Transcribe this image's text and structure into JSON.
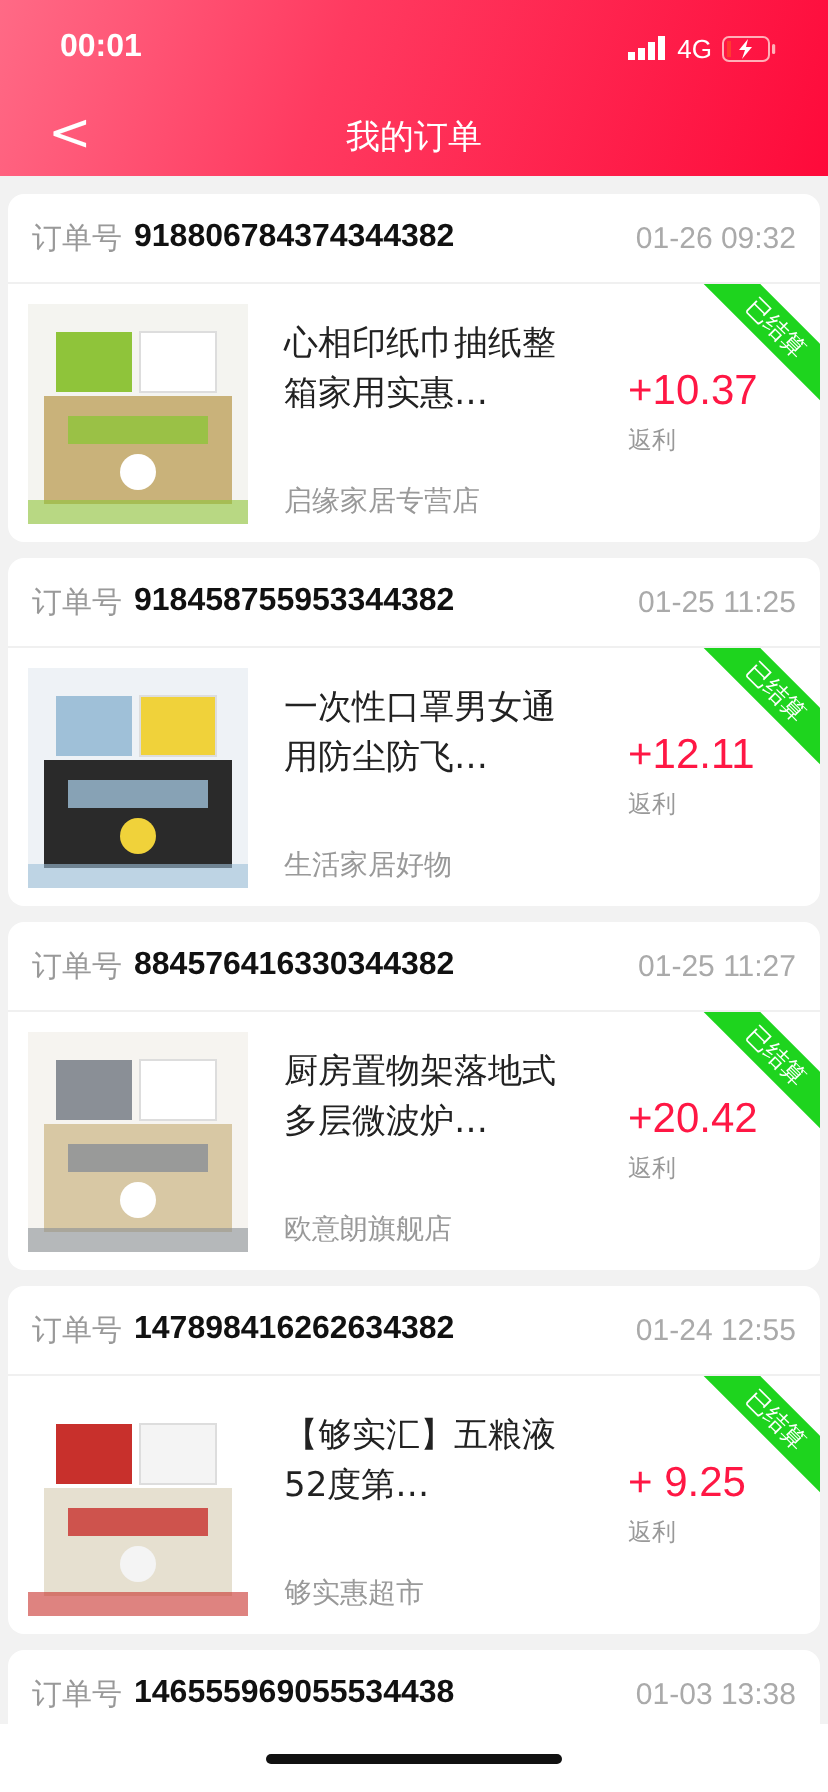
{
  "status_bar": {
    "time": "00:01",
    "network": "4G"
  },
  "header": {
    "back": "<",
    "title": "我的订单"
  },
  "orders": [
    {
      "label": "订单号",
      "number": "918806784374344382",
      "time": "01-26 09:32",
      "product": {
        "title": "心相印纸巾抽纸整箱家用实惠…",
        "store": "启缘家居专营店",
        "amount": "+10.37",
        "amount_label": "返利",
        "settled": true,
        "badge": "已结算"
      }
    },
    {
      "label": "订单号",
      "number": "918458755953344382",
      "time": "01-25 11:25",
      "product": {
        "title": "一次性口罩男女通用防尘防飞…",
        "store": "生活家居好物",
        "amount": "+12.11",
        "amount_label": "返利",
        "settled": true,
        "badge": "已结算"
      }
    },
    {
      "label": "订单号",
      "number": "884576416330344382",
      "time": "01-25 11:27",
      "product": {
        "title": "厨房置物架落地式多层微波炉…",
        "store": "欧意朗旗舰店",
        "amount": "+20.42",
        "amount_label": "返利",
        "settled": true,
        "badge": "已结算"
      }
    },
    {
      "label": "订单号",
      "number": "147898416262634382",
      "time": "01-24 12:55",
      "product": {
        "title": "【够实汇】五粮液52度第…",
        "store": "够实惠超市",
        "amount": "+ 9.25",
        "amount_label": "返利",
        "settled": true,
        "badge": "已结算"
      }
    },
    {
      "label": "订单号",
      "number": "146555969055534438",
      "time": "01-03 13:38"
    }
  ]
}
